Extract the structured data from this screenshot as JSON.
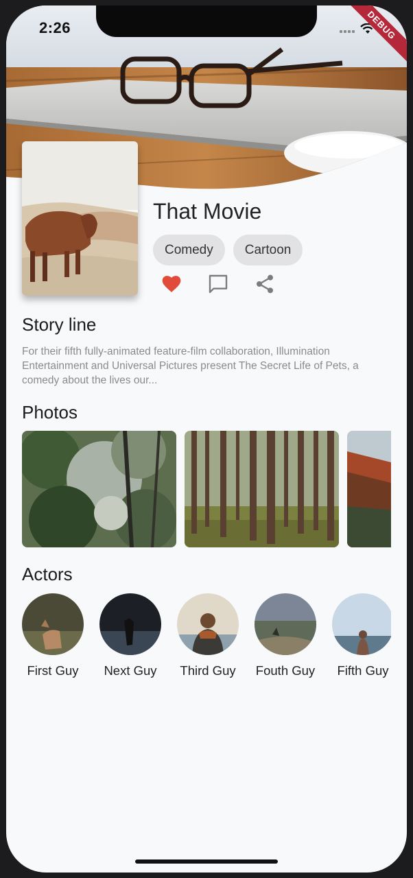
{
  "status_bar": {
    "time": "2:26",
    "debug_label": "DEBUG"
  },
  "movie": {
    "title": "That Movie",
    "genres": [
      "Comedy",
      "Cartoon"
    ],
    "actions": [
      {
        "icon": "heart-icon",
        "color": "#e04b3a"
      },
      {
        "icon": "comment-icon",
        "color": "#7c7c80"
      },
      {
        "icon": "share-icon",
        "color": "#7c7c80"
      }
    ]
  },
  "storyline": {
    "heading": "Story line",
    "text": "For their fifth fully-animated feature-film collaboration, Illumination Entertainment and Universal Pictures present The Secret Life of Pets, a comedy about the lives our..."
  },
  "photos": {
    "heading": "Photos",
    "count_visible": 3
  },
  "actors": {
    "heading": "Actors",
    "items": [
      {
        "name": "First Guy"
      },
      {
        "name": "Next Guy"
      },
      {
        "name": "Third Guy"
      },
      {
        "name": "Fouth Guy"
      },
      {
        "name": "Fifth Guy"
      }
    ]
  },
  "colors": {
    "background": "#f8f9fb",
    "chip": "#e2e2e4",
    "accent_heart": "#e04b3a"
  }
}
